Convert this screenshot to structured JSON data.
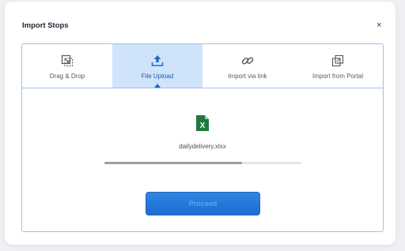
{
  "dialog": {
    "title": "Import Stops",
    "close_label": "×"
  },
  "tabs": [
    {
      "label": "Drag & Drop",
      "icon": "drag-drop-icon",
      "active": false
    },
    {
      "label": "File Upload",
      "icon": "upload-icon",
      "active": true
    },
    {
      "label": "Import via link",
      "icon": "link-icon",
      "active": false
    },
    {
      "label": "Import from Portal",
      "icon": "portal-icon",
      "active": false
    }
  ],
  "upload": {
    "file_icon": "excel-file-icon",
    "filename": "dailydelivery.xlsx",
    "progress": 0.7
  },
  "actions": {
    "proceed_label": "Proceed"
  },
  "colors": {
    "accent": "#1a6fd1",
    "tab_active_bg": "#cfe3fb",
    "excel_green": "#1e7a3c"
  }
}
